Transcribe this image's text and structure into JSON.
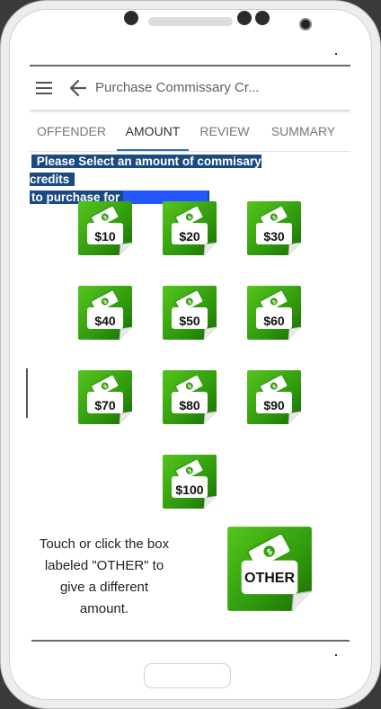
{
  "appbar": {
    "title": "Purchase Commissary Cr...",
    "menu_icon": "menu-icon",
    "back_icon": "back-arrow-icon"
  },
  "tabs": [
    {
      "label": "OFFENDER",
      "active": false
    },
    {
      "label": "AMOUNT",
      "active": true
    },
    {
      "label": "REVIEW",
      "active": false
    },
    {
      "label": "SUMMARY",
      "active": false
    }
  ],
  "prompt": {
    "line1": "Please Select an amount of commisary credits",
    "line2": "to purchase for",
    "redacted_name": "XXXXXXXXXX"
  },
  "amounts": [
    {
      "label": "$10"
    },
    {
      "label": "$20"
    },
    {
      "label": "$30"
    },
    {
      "label": "$40"
    },
    {
      "label": "$50"
    },
    {
      "label": "$60"
    },
    {
      "label": "$70"
    },
    {
      "label": "$80"
    },
    {
      "label": "$90"
    },
    {
      "label": "$100"
    }
  ],
  "hint": {
    "line1": "Touch or click the box",
    "line2": "labeled \"OTHER\" to",
    "line3": "give a different",
    "line4": "amount."
  },
  "other": {
    "label": "OTHER"
  },
  "colors": {
    "accent_tab": "#2a6fb0",
    "tile_green": "#3a9e12",
    "tile_green_dark": "#1f6e06",
    "prompt_bg": "#1a4a80"
  }
}
